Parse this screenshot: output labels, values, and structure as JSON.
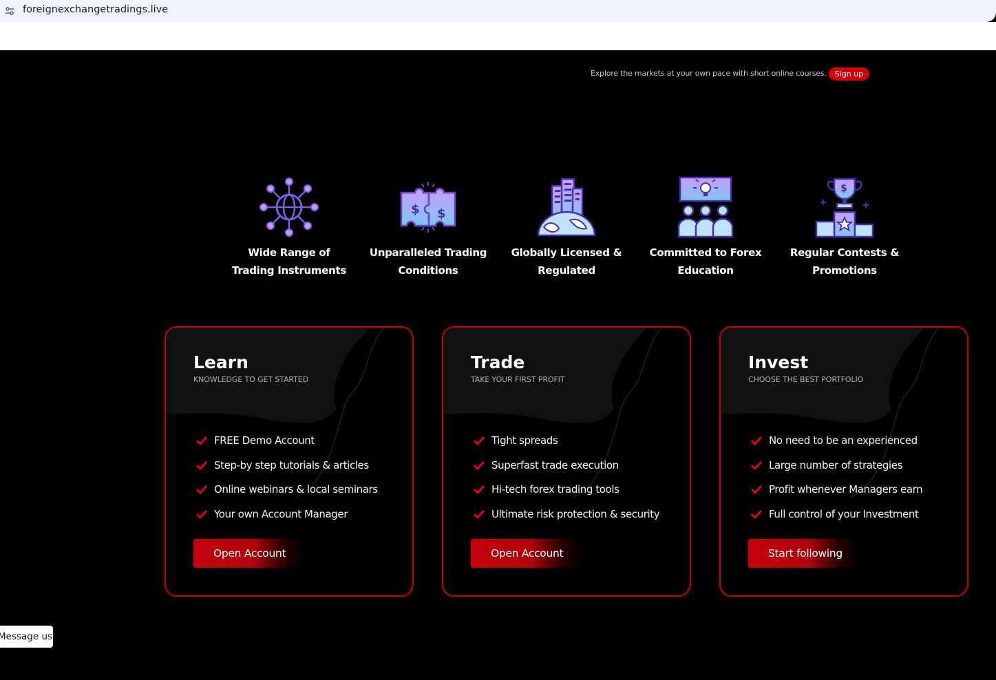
{
  "browser": {
    "url": "foreignexchangetradings.live"
  },
  "promo": {
    "text": "Explore the markets at your own pace with short online courses.",
    "signup_label": "Sign up"
  },
  "features": [
    {
      "line1": "Wide Range of",
      "line2": "Trading Instruments",
      "icon": "globe-network-icon"
    },
    {
      "line1": "Unparalleled Trading",
      "line2": "Conditions",
      "icon": "dollar-puzzle-icon"
    },
    {
      "line1": "Globally Licensed &",
      "line2": "Regulated",
      "icon": "globe-buildings-icon"
    },
    {
      "line1": "Committed to Forex",
      "line2": "Education",
      "icon": "education-people-icon"
    },
    {
      "line1": "Regular Contests &",
      "line2": "Promotions",
      "icon": "trophy-podium-icon"
    }
  ],
  "cards": [
    {
      "title": "Learn",
      "subtitle": "KNOWLEDGE TO GET STARTED",
      "items": [
        "FREE Demo Account",
        "Step-by step tutorials & articles",
        "Online webinars & local seminars",
        "Your own Account Manager"
      ],
      "button": "Open Account"
    },
    {
      "title": "Trade",
      "subtitle": "TAKE YOUR FIRST PROFIT",
      "items": [
        "Tight spreads",
        "Superfast trade execution",
        "Hi-tech forex trading tools",
        "Ultimate risk protection & security"
      ],
      "button": "Open Account"
    },
    {
      "title": "Invest",
      "subtitle": "CHOOSE THE BEST PORTFOLIO",
      "items": [
        "No need to be an experienced",
        "Large number of strategies",
        "Profit whenever Managers earn",
        "Full control of your Investment"
      ],
      "button": "Start following"
    }
  ],
  "message": {
    "label": "Message us"
  },
  "colors": {
    "accent": "#d10000",
    "icon_purple": "#a56cf2",
    "icon_blue": "#6d8ff0"
  }
}
